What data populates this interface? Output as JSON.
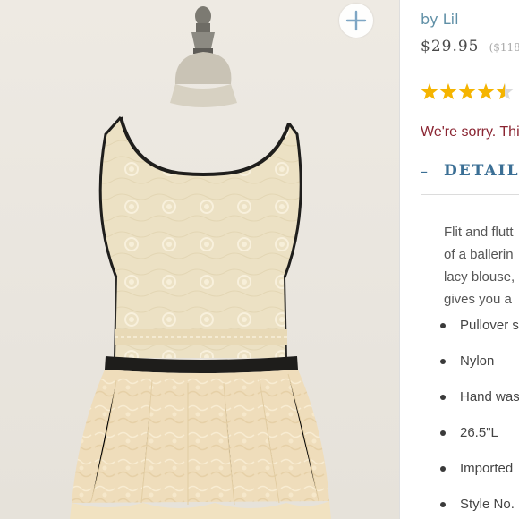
{
  "product": {
    "brand": "by Lil",
    "price": "$29.95",
    "original_price": "($118",
    "rating_stars": 4.5,
    "rating_max": 5,
    "star_color": "#f5b400",
    "notice": "We're sorry. Thi",
    "accent_color": "#3b6f95"
  },
  "image": {
    "zoom_icon": "plus-icon",
    "subject": "cream lace peplum top on dress form"
  },
  "details": {
    "toggle_symbol": "–",
    "label": "DETAILS",
    "description_lines": [
      "Flit and flutt",
      "of a ballerin",
      "lacy blouse,",
      "gives you a"
    ],
    "features": [
      "Pullover s",
      "Nylon",
      "Hand was",
      "26.5\"L",
      "Imported",
      "Style No."
    ]
  }
}
